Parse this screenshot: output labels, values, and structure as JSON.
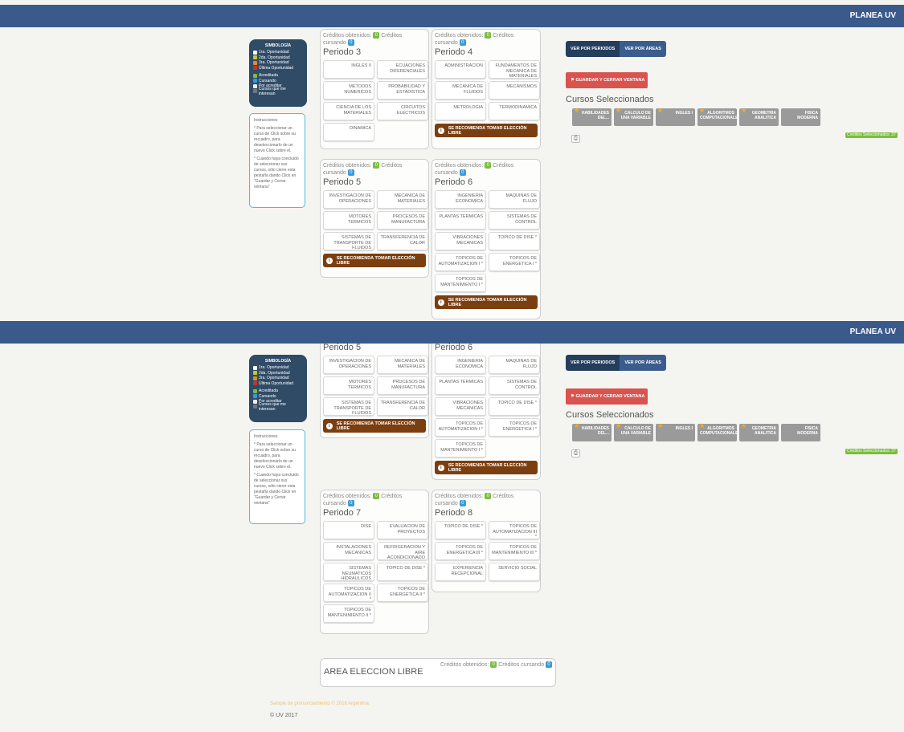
{
  "brand": "PLANEA UV",
  "legend": {
    "title": "SIMBOLOGÍA",
    "items": [
      {
        "label": "1ra. Oportunidad",
        "color": "#ffffff"
      },
      {
        "label": "2da. Oportunidad",
        "color": "#c8c82a"
      },
      {
        "label": "3ra. Oportunidad",
        "color": "#e08a2a"
      },
      {
        "label": "Última Oportunidad",
        "color": "#c9302c"
      },
      {
        "label": "Acreditada",
        "color": "#7cbd3e"
      },
      {
        "label": "Cursando",
        "color": "#3a9ad9"
      },
      {
        "label": "Por acreditar",
        "color": "#eeeeee"
      },
      {
        "label": "Cursos que me interesan",
        "color": "#777777"
      }
    ]
  },
  "instructions": {
    "title": "Instrucciones",
    "p1": "* Para seleccionar un curso de Click sobre su recuadro, para deseleccionarlo de un nuevo Click sobre el.",
    "p2": "* Cuando haya concluido de seleccionar sus cursos, sólo cierre esta pestaña dando Click en \"Guardar y Cerrar ventana\""
  },
  "credits": {
    "obtained_label": "Créditos obtenidos:",
    "current_label": "Créditos cursando",
    "obtained": "0",
    "current": "0"
  },
  "recommend": "SE RECOMIENDA TOMAR ELECCIÓN LIBRE",
  "periods": {
    "p3": {
      "title": "Periodo 3",
      "courses": [
        "INGLES II",
        "ECUACIONES DIFERENCIALES",
        "METODOS NUMERICOS",
        "PROBABILIDAD Y ESTADISTICA",
        "CIENCIA DE LOS MATERIALES",
        "CIRCUITOS ELECTRICOS",
        "DINAMICA"
      ]
    },
    "p4": {
      "title": "Periodo 4",
      "courses": [
        "ADMINISTRACION",
        "FUNDAMENTOS DE MECANICA DE MATERIALES",
        "MECANICA DE FLUIDOS",
        "MECANISMOS",
        "METROLOGIA",
        "TERMODINAMICA"
      ]
    },
    "p5": {
      "title": "Periodo 5",
      "courses": [
        "INVESTIGACION DE OPERACIONES",
        "MECANICA DE MATERIALES",
        "MOTORES TERMICOS",
        "PROCESOS DE MANUFACTURA",
        "SISTEMAS DE TRANSPORTE DE FLUIDOS",
        "TRANSFERENCIA DE CALOR"
      ]
    },
    "p6": {
      "title": "Periodo 6",
      "courses": [
        "INGENIERIA ECONOMICA",
        "MAQUINAS DE FLUJO",
        "PLANTAS TERMICAS",
        "SISTEMAS DE CONTROL",
        "VIBRACIONES MECANICAS",
        "TOPICO DE DISE *",
        "TOPICOS DE AUTOMATIZACION I *",
        "TOPICOS DE ENERGETICA I *",
        "TOPICOS DE MANTENIMIENTO I *"
      ]
    },
    "p7": {
      "title": "Periodo 7",
      "courses": [
        "DISE",
        "EVALUACION DE PROYECTOS",
        "INSTALACIONES MECANICAS",
        "REFRIGERACION Y AIRE ACONDICIONADO",
        "SISTEMAS NEUMATICOS HIDRAULICOS",
        "TOPICO DE DISE *",
        "TOPICOS DE AUTOMATIZACION II *",
        "TOPICOS DE ENERGETICA II *",
        "TOPICOS DE MANTENIMIENTO II *"
      ]
    },
    "p8": {
      "title": "Periodo 8",
      "courses": [
        "TOPICO DE DISE *",
        "TOPICOS DE AUTOMATIZACION III *",
        "TOPICOS DE ENERGETICA III *",
        "TOPICOS DE MANTENIMIENTO III *",
        "EXPERIENCIA RECEPCIONAL",
        "SERVICIO SOCIAL"
      ]
    }
  },
  "tabs": {
    "by_period": "VER POR PERIODOS",
    "by_area": "VER POR ÁREAS"
  },
  "save_button": "GUARDAR Y CERRAR VENTANA",
  "selected": {
    "title": "Cursos Seleccionados",
    "courses": [
      "HABILIDADES DEL...",
      "CALCULO DE UNA VARIABLE",
      "INGLES I",
      "ALGORITMOS COMPUTACIONALES",
      "GEOMETRIA ANALITICA",
      "FISICA MODERNA"
    ],
    "credits_label": "Créditos Seleccionados: 37"
  },
  "area_libre": {
    "title": "AREA ELECCION LIBRE"
  },
  "footnote": "Sample de pronunciamiento © 2016 Argentina",
  "copyright": "© UV 2017"
}
